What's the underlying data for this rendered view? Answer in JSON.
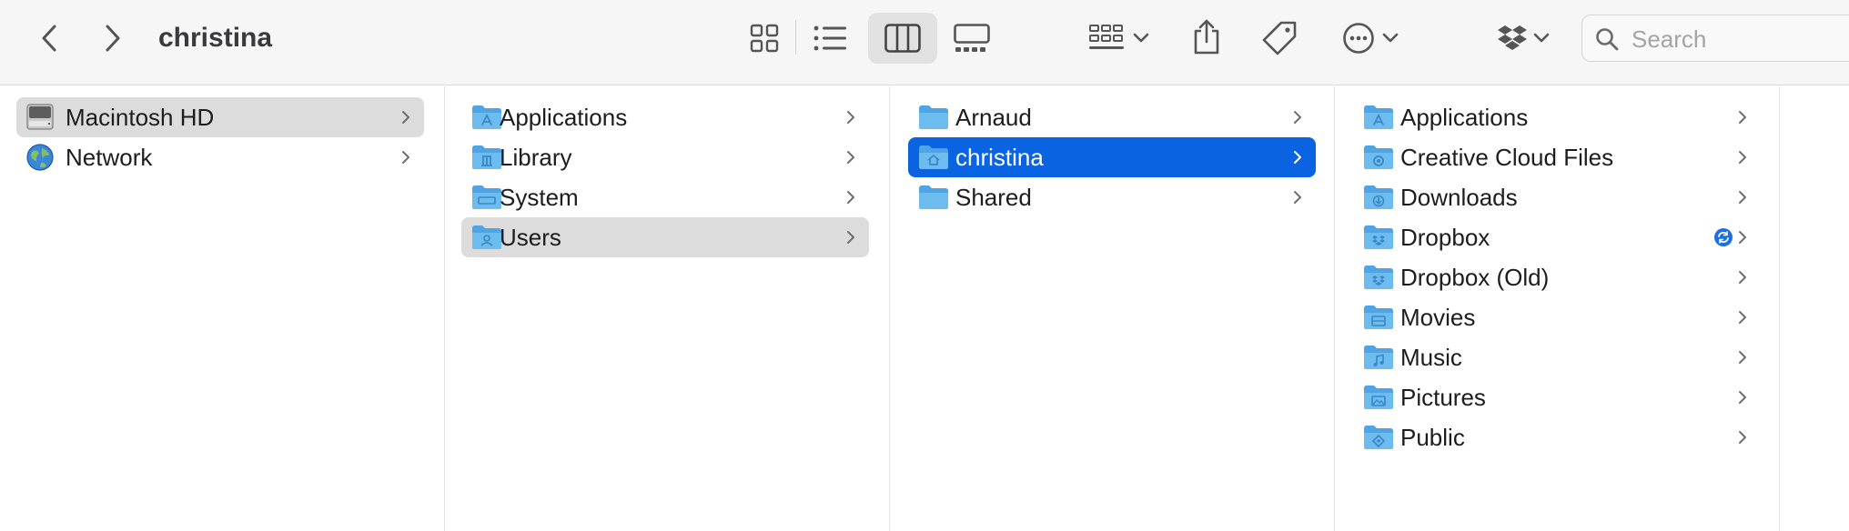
{
  "window": {
    "title": "christina"
  },
  "toolbar": {
    "back": "chevron-left-icon",
    "forward": "chevron-right-icon",
    "views": [
      "icon-view-icon",
      "list-view-icon",
      "column-view-icon",
      "gallery-view-icon"
    ],
    "active_view": "column-view-icon",
    "group_by": "group-icon",
    "share": "share-icon",
    "tags": "tag-icon",
    "actions": "ellipsis-circle-icon",
    "dropbox": "dropbox-icon",
    "search_placeholder": "Search"
  },
  "columns": [
    {
      "items": [
        {
          "label": "Macintosh HD",
          "icon": "hard-drive-icon",
          "state": "selected-inactive"
        },
        {
          "label": "Network",
          "icon": "network-globe-icon",
          "state": "none"
        }
      ]
    },
    {
      "items": [
        {
          "label": "Applications",
          "icon": "folder-applications-icon",
          "state": "none"
        },
        {
          "label": "Library",
          "icon": "folder-library-icon",
          "state": "none"
        },
        {
          "label": "System",
          "icon": "folder-system-icon",
          "state": "none"
        },
        {
          "label": "Users",
          "icon": "folder-users-icon",
          "state": "selected-inactive"
        }
      ]
    },
    {
      "items": [
        {
          "label": "Arnaud",
          "icon": "folder-icon",
          "state": "none"
        },
        {
          "label": "christina",
          "icon": "folder-home-icon",
          "state": "selected-active"
        },
        {
          "label": "Shared",
          "icon": "folder-icon",
          "state": "none"
        }
      ]
    },
    {
      "items": [
        {
          "label": "Applications",
          "icon": "folder-applications-icon",
          "state": "none"
        },
        {
          "label": "Creative Cloud Files",
          "icon": "folder-creative-cloud-icon",
          "state": "none"
        },
        {
          "label": "Downloads",
          "icon": "folder-downloads-icon",
          "state": "none"
        },
        {
          "label": "Dropbox",
          "icon": "folder-dropbox-icon",
          "state": "none",
          "badge": "sync-icon"
        },
        {
          "label": "Dropbox (Old)",
          "icon": "folder-dropbox-icon",
          "state": "none"
        },
        {
          "label": "Movies",
          "icon": "folder-movies-icon",
          "state": "none"
        },
        {
          "label": "Music",
          "icon": "folder-music-icon",
          "state": "none"
        },
        {
          "label": "Pictures",
          "icon": "folder-pictures-icon",
          "state": "none"
        },
        {
          "label": "Public",
          "icon": "folder-public-icon",
          "state": "none"
        }
      ]
    }
  ],
  "colors": {
    "accent": "#0a63e0",
    "selection_inactive": "#dcdcdc",
    "folder": "#5aaee8"
  }
}
